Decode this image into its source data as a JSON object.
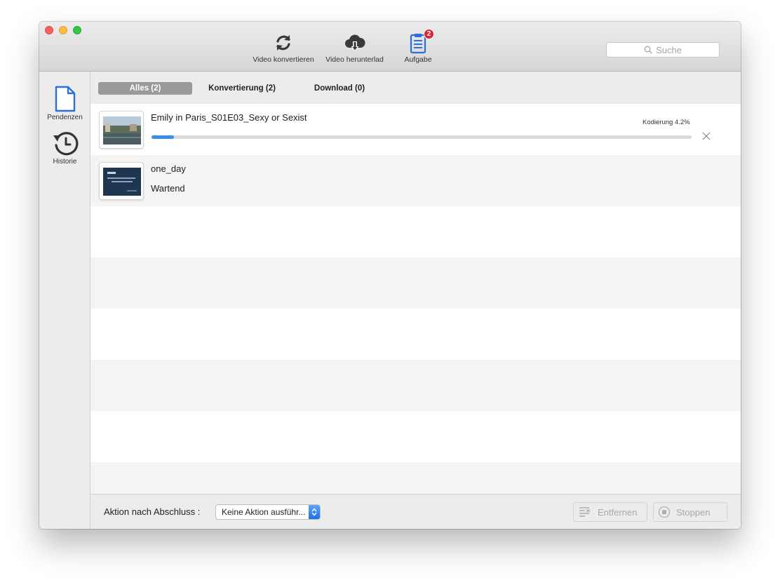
{
  "toolbar": {
    "convert_label": "Video konvertieren",
    "download_label": "Video herunterlad",
    "task_label": "Aufgabe",
    "task_badge": "2",
    "search_placeholder": "Suche"
  },
  "sidebar": {
    "items": [
      {
        "label": "Pendenzen",
        "icon": "document-icon"
      },
      {
        "label": "Historie",
        "icon": "history-clock-icon"
      }
    ]
  },
  "tabs": [
    {
      "label": "Alles (2)",
      "active": true
    },
    {
      "label": "Konvertierung (2)",
      "active": false
    },
    {
      "label": "Download (0)",
      "active": false
    }
  ],
  "tasks": [
    {
      "title": "Emily in Paris_S01E03_Sexy or Sexist",
      "progress_label": "Kodierung 4.2%",
      "progress": 0.042
    },
    {
      "title": "one_day",
      "status": "Wartend"
    }
  ],
  "bottom": {
    "action_label": "Aktion nach Abschluss :",
    "action_value": "Keine Aktion ausführ...",
    "remove_label": "Entfernen",
    "stop_label": "Stoppen"
  },
  "colors": {
    "accent": "#3a8ef2",
    "badge": "#e0242b",
    "task_icon": "#2c6fd6"
  }
}
